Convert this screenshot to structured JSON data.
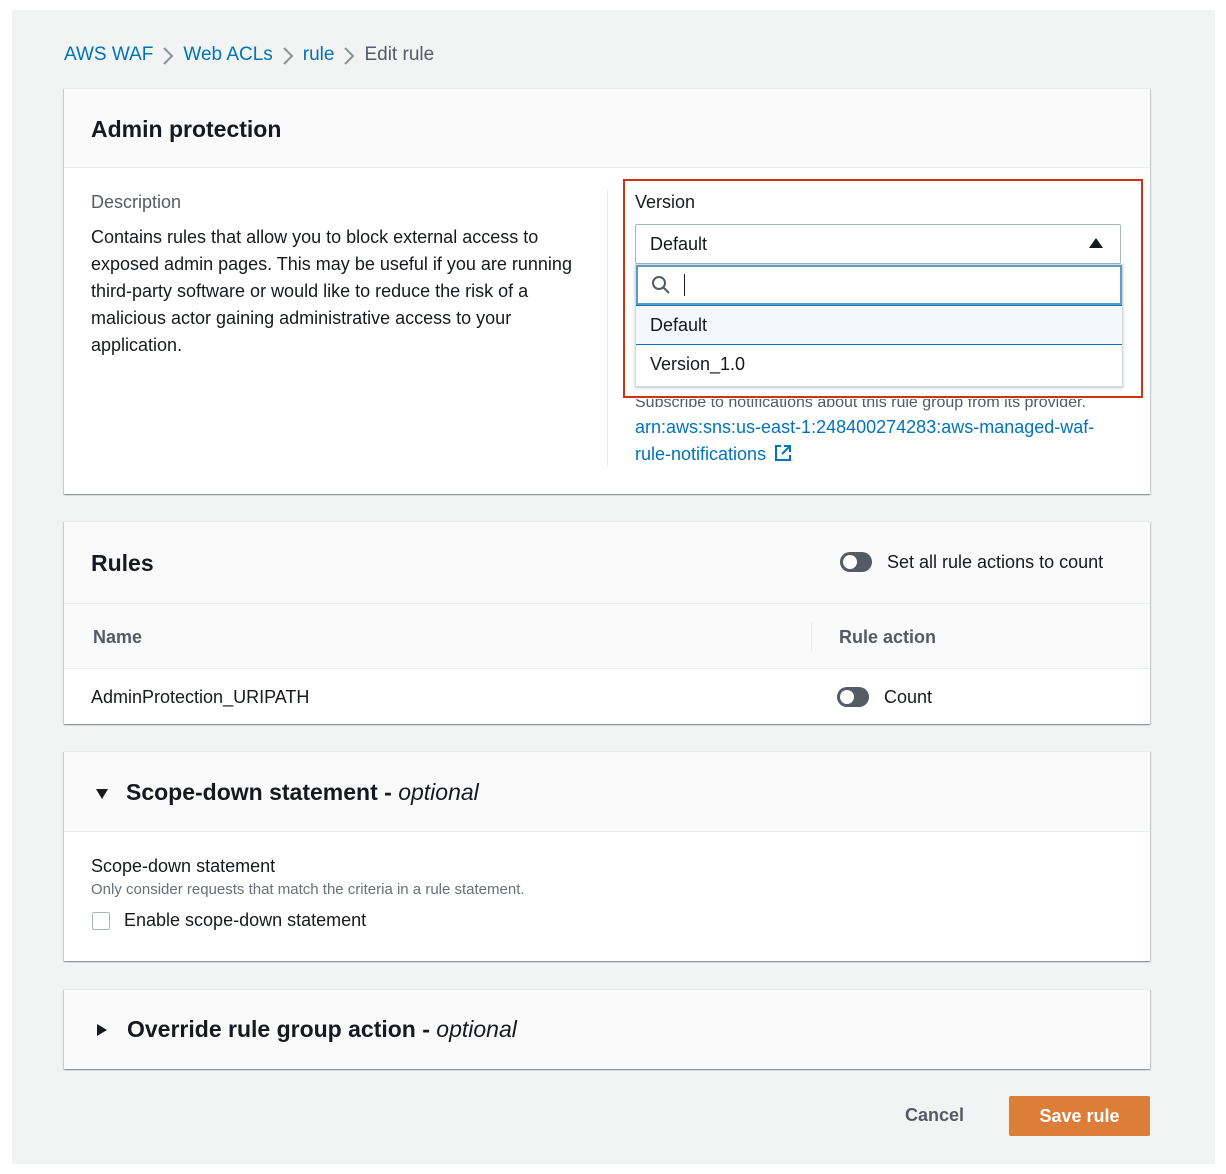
{
  "breadcrumb": {
    "items": [
      "AWS WAF",
      "Web ACLs",
      "rule"
    ],
    "current": "Edit rule"
  },
  "admin_panel": {
    "title": "Admin protection",
    "description_label": "Description",
    "description_text": "Contains rules that allow you to block external access to exposed admin pages. This may be useful if you are running third-party software or would like to reduce the risk of a malicious actor gaining administrative access to your application.",
    "version": {
      "label": "Version",
      "selected": "Default",
      "search_value": "",
      "options": [
        "Default",
        "Version_1.0"
      ]
    },
    "sns_note": "Subscribe to notifications about this rule group from its provider.",
    "sns_arn": "arn:aws:sns:us-east-1:248400274283:aws-managed-waf-rule-notifications"
  },
  "rules_panel": {
    "title": "Rules",
    "toggle_all_label": "Set all rule actions to count",
    "toggle_all_on": false,
    "columns": [
      "Name",
      "Rule action"
    ],
    "rows": [
      {
        "name": "AdminProtection_URIPATH",
        "action": "Count",
        "toggle_on": false
      }
    ]
  },
  "scope_panel": {
    "title": "Scope-down statement - ",
    "title_optional": "optional",
    "field_label": "Scope-down statement",
    "field_help": "Only consider requests that match the criteria in a rule statement.",
    "checkbox_label": "Enable scope-down statement",
    "checked": false
  },
  "override_panel": {
    "title": "Override rule group action - ",
    "title_optional": "optional"
  },
  "footer": {
    "cancel_label": "Cancel",
    "save_label": "Save rule"
  },
  "colors": {
    "link": "#0073bb",
    "primary_button": "#dc7e38",
    "highlight": "#d13212"
  }
}
